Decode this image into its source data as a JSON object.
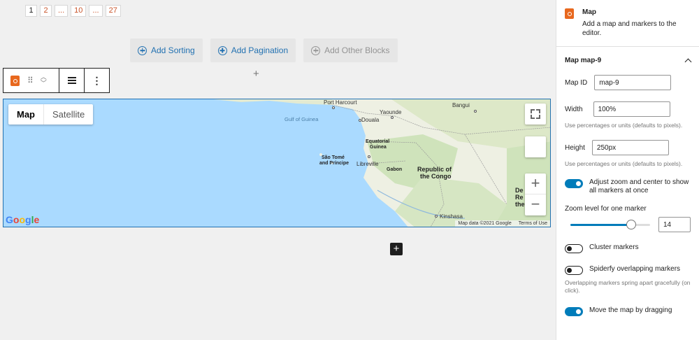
{
  "pagination": [
    "1",
    "2",
    "...",
    "10",
    "...",
    "27"
  ],
  "block_buttons": {
    "add_sorting": "Add Sorting",
    "add_pagination": "Add Pagination",
    "add_other": "Add Other Blocks"
  },
  "map": {
    "type_map": "Map",
    "type_satellite": "Satellite",
    "zoom_in": "+",
    "zoom_out": "−",
    "google": "Google",
    "attribution": "Map data ©2021 Google",
    "terms": "Terms of Use",
    "labels": {
      "port_harcourt": "Port Harcourt",
      "bangui": "Bangui",
      "yaounde": "Yaounde",
      "gulf": "Gulf of Guinea",
      "douala": "Douala",
      "eq_guinea_1": "Equatorial",
      "eq_guinea_2": "Guinea",
      "sao_tome_1": "São Tomé",
      "sao_tome_2": "and Príncipe",
      "libreville": "Libreville",
      "gabon": "Gabon",
      "congo_1": "Republic of",
      "congo_2": "the Congo",
      "drc_1": "De",
      "drc_2": "Re",
      "drc_3": "the",
      "kinshasa": "Kinshasa"
    }
  },
  "sidebar": {
    "block_title": "Map",
    "block_desc": "Add a map and markers to the editor.",
    "panel_title": "Map map-9",
    "map_id_label": "Map ID",
    "map_id_value": "map-9",
    "width_label": "Width",
    "width_value": "100%",
    "width_help": "Use percentages or units (defaults to pixels).",
    "height_label": "Height",
    "height_value": "250px",
    "height_help": "Use percentages or units (defaults to pixels).",
    "adjust_zoom_label": "Adjust zoom and center to show all markers at once",
    "zoom_level_label": "Zoom level for one marker",
    "zoom_level_value": "14",
    "zoom_slider_fraction": 0.76,
    "cluster_label": "Cluster markers",
    "spiderfy_label": "Spiderfy overlapping markers",
    "spiderfy_help": "Overlapping markers spring apart gracefully (on click).",
    "drag_label": "Move the map by dragging"
  }
}
